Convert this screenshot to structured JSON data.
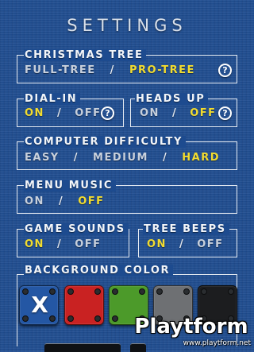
{
  "title": "SETTINGS",
  "christmas_tree": {
    "label": "CHRISTMAS TREE",
    "options": [
      "FULL-TREE",
      "PRO-TREE"
    ],
    "selected": "PRO-TREE",
    "help": "?"
  },
  "dial_in": {
    "label": "DIAL-IN",
    "options": [
      "ON",
      "OFF"
    ],
    "selected": "ON",
    "help": "?"
  },
  "heads_up": {
    "label": "HEADS UP",
    "options": [
      "ON",
      "OFF"
    ],
    "selected": "OFF",
    "help": "?"
  },
  "computer_difficulty": {
    "label": "COMPUTER DIFFICULTY",
    "options": [
      "EASY",
      "MEDIUM",
      "HARD"
    ],
    "selected": "HARD"
  },
  "menu_music": {
    "label": "MENU MUSIC",
    "options": [
      "ON",
      "OFF"
    ],
    "selected": "OFF"
  },
  "game_sounds": {
    "label": "GAME SOUNDS",
    "options": [
      "ON",
      "OFF"
    ],
    "selected": "ON"
  },
  "tree_beeps": {
    "label": "TREE BEEPS",
    "options": [
      "ON",
      "OFF"
    ],
    "selected": "ON"
  },
  "background_color": {
    "label": "BACKGROUND COLOR",
    "selected_mark": "X",
    "swatches": [
      {
        "name": "blue",
        "color": "#1d4b8f",
        "selected": true
      },
      {
        "name": "red",
        "color": "#c92222",
        "selected": false
      },
      {
        "name": "green",
        "color": "#4c9a2a",
        "selected": false
      },
      {
        "name": "gray",
        "color": "#6e7073",
        "selected": false
      },
      {
        "name": "black",
        "color": "#1c1d1f",
        "selected": false
      }
    ]
  },
  "separator": "/",
  "colors": {
    "selected_option": "#f2dc2f",
    "unselected_option": "#c8d0dc",
    "frame": "#e6ebf2"
  },
  "watermark": {
    "brand": "Playtform",
    "url": "www.playtform.net"
  }
}
